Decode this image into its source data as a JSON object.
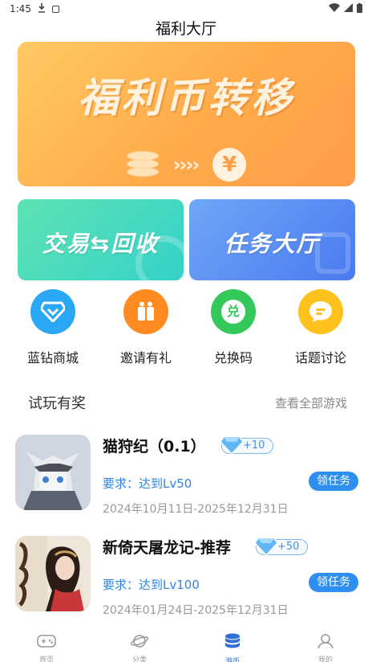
{
  "status": {
    "time": "1:45"
  },
  "page": {
    "title": "福利大厅"
  },
  "banner": {
    "headline": "福利币转移",
    "arrows": "››››",
    "yen": "¥"
  },
  "cards": [
    {
      "label": "交易⇆回收",
      "color": "#34d2c9"
    },
    {
      "label": "任务大厅",
      "color": "#4a7af0"
    }
  ],
  "shortcuts": [
    {
      "label": "蓝钻商城",
      "icon": "diamond-icon",
      "color": "#2aa7f5"
    },
    {
      "label": "邀请有礼",
      "icon": "gift-icon",
      "color": "#ff8a1f"
    },
    {
      "label": "兑换码",
      "icon": "redeem-code-icon",
      "glyph": "兑",
      "color": "#34c759"
    },
    {
      "label": "话题讨论",
      "icon": "chat-icon",
      "color": "#ffc21d"
    }
  ],
  "section": {
    "title": "试玩有奖",
    "link": "查看全部游戏"
  },
  "games": [
    {
      "name": "猫狩纪（0.1）",
      "reward": "+10",
      "requirement": "要求：达到Lv50",
      "button": "领任务",
      "dates": "2024年10月11日-2025年12月31日"
    },
    {
      "name": "新倚天屠龙记-推荐",
      "reward": "+50",
      "requirement": "要求：达到Lv100",
      "button": "领任务",
      "dates": "2024年01月24日-2025年12月31日"
    }
  ],
  "tabs": [
    {
      "label": "首页",
      "icon": "gamepad-icon"
    },
    {
      "label": "分类",
      "icon": "planet-icon"
    },
    {
      "label": "游币",
      "icon": "coins-icon",
      "active": true
    },
    {
      "label": "我的",
      "icon": "profile-icon"
    }
  ],
  "colors": {
    "accent": "#2f8ff0",
    "banner": "#ffab4a",
    "active_tab": "#2f6fd6"
  }
}
